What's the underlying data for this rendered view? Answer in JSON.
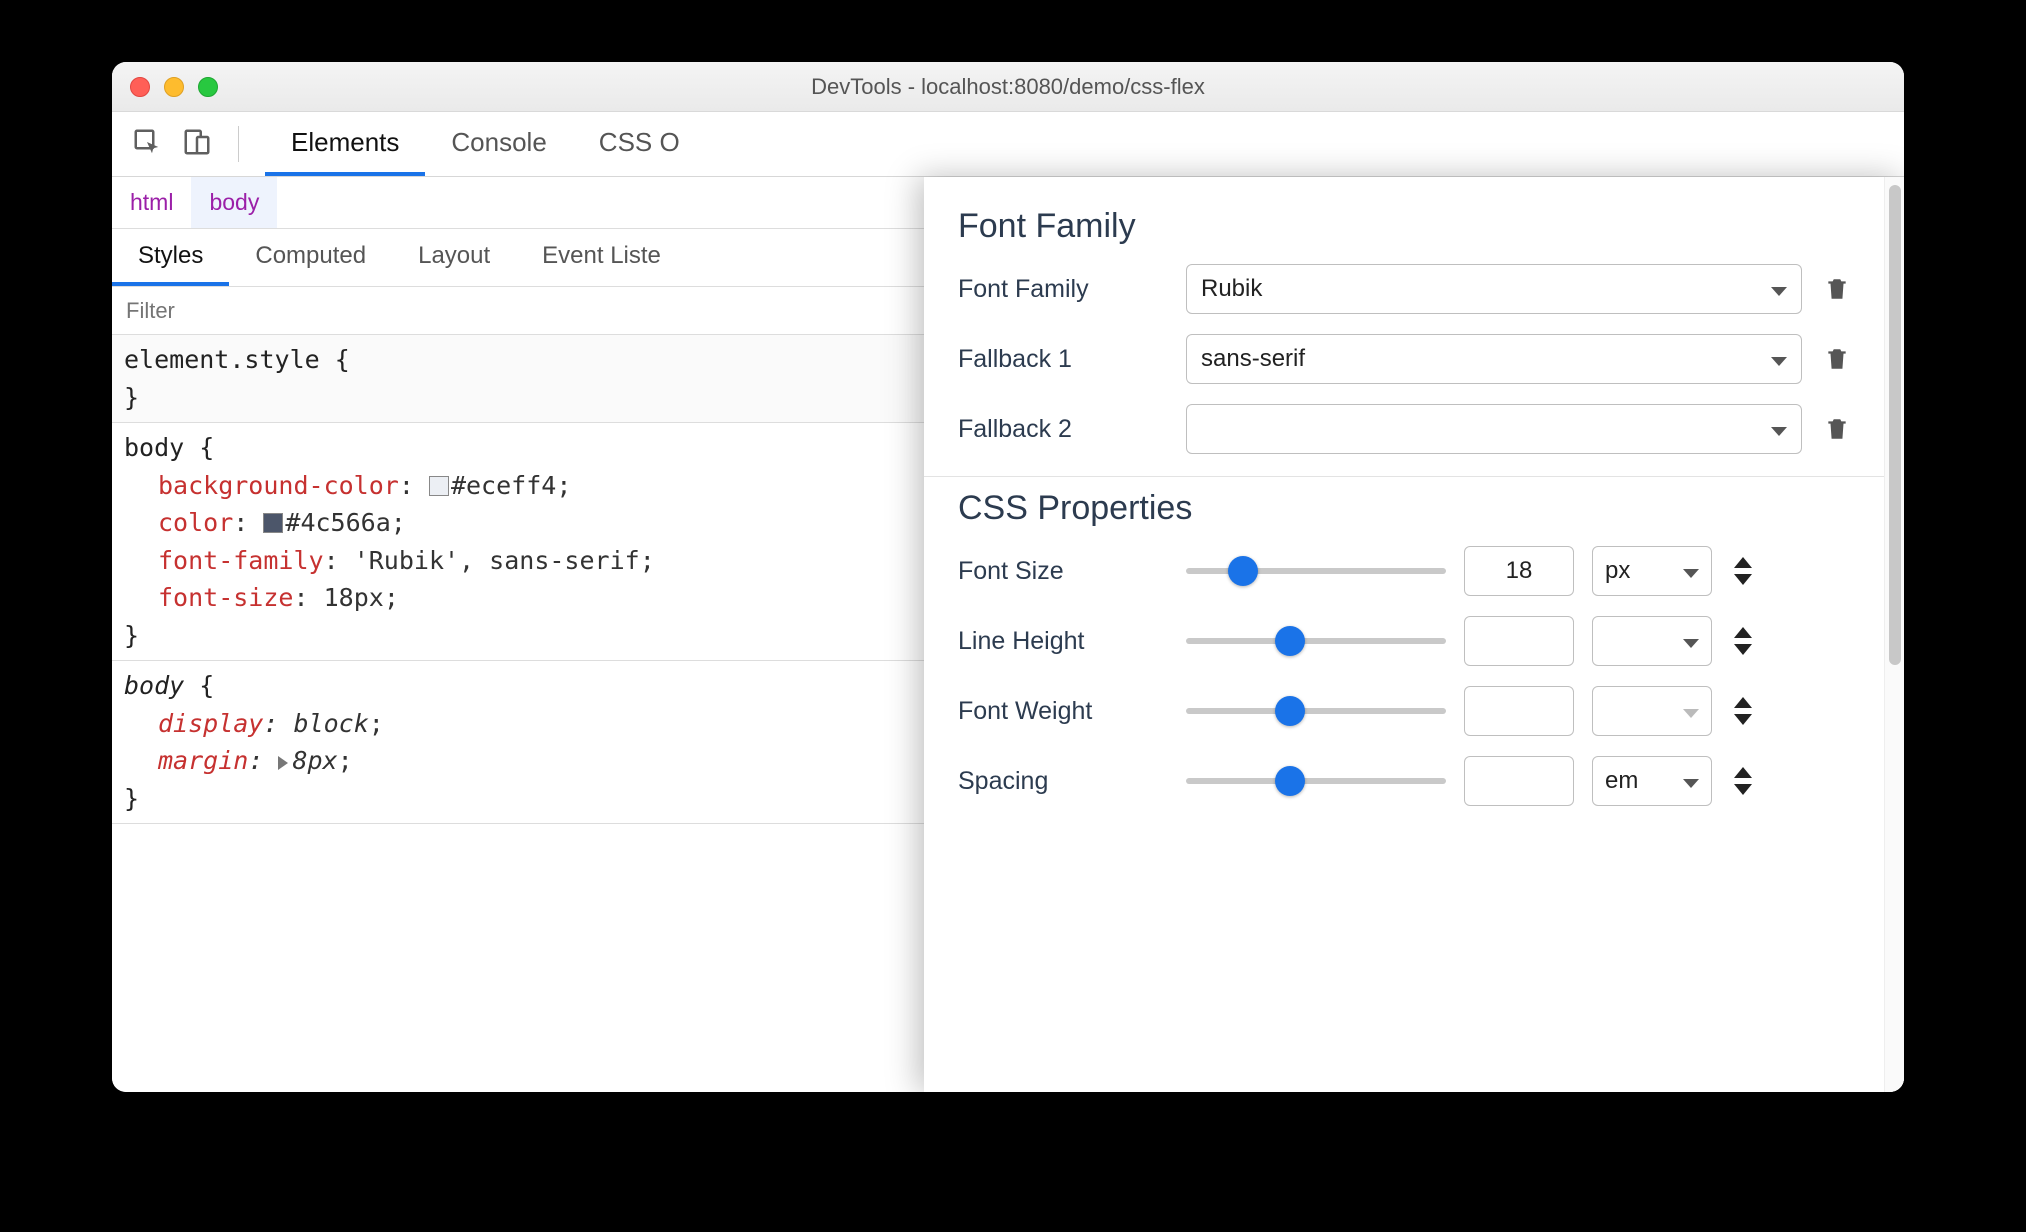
{
  "window": {
    "title": "DevTools - localhost:8080/demo/css-flex"
  },
  "tabs": {
    "elements": "Elements",
    "console": "Console",
    "cssOverview": "CSS O"
  },
  "breadcrumbs": {
    "html": "html",
    "body": "body"
  },
  "subtabs": {
    "styles": "Styles",
    "computed": "Computed",
    "layout": "Layout",
    "eventListeners": "Event Liste"
  },
  "filter": {
    "placeholder": "Filter"
  },
  "rules": {
    "elementStyle": {
      "selector": "element.style",
      "open": "{",
      "close": "}"
    },
    "body1": {
      "selector": "body",
      "open": "{",
      "close": "}",
      "decls": [
        {
          "prop": "background-color",
          "swatch": "#eceff4",
          "value": "#eceff4"
        },
        {
          "prop": "color",
          "swatch": "#4c566a",
          "value": "#4c566a"
        },
        {
          "prop": "font-family",
          "value": "'Rubik', sans-serif"
        },
        {
          "prop": "font-size",
          "value": "18px"
        }
      ]
    },
    "body2": {
      "selector": "body",
      "open": "{",
      "close": "}",
      "italic": true,
      "decls": [
        {
          "prop": "display",
          "value": "block"
        },
        {
          "prop": "margin",
          "value": "8px",
          "expandable": true
        }
      ]
    }
  },
  "panel": {
    "fontFamily": {
      "title": "Font Family",
      "rows": [
        {
          "label": "Font Family",
          "value": "Rubik"
        },
        {
          "label": "Fallback 1",
          "value": "sans-serif"
        },
        {
          "label": "Fallback 2",
          "value": ""
        }
      ]
    },
    "cssProps": {
      "title": "CSS Properties",
      "rows": [
        {
          "label": "Font Size",
          "value": "18",
          "unit": "px",
          "sliderPos": 22
        },
        {
          "label": "Line Height",
          "value": "",
          "unit": "",
          "sliderPos": 40
        },
        {
          "label": "Font Weight",
          "value": "",
          "unit": "",
          "unitMuted": true,
          "sliderPos": 40
        },
        {
          "label": "Spacing",
          "value": "",
          "unit": "em",
          "sliderPos": 40
        }
      ]
    }
  }
}
